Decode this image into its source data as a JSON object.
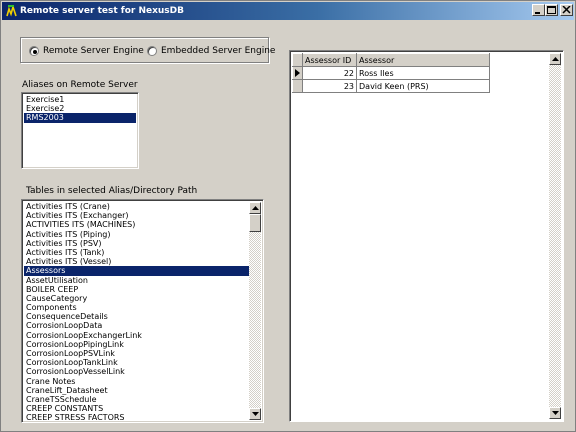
{
  "window": {
    "title": "Remote server test for NexusDB"
  },
  "engine": {
    "remote_label": "Remote Server Engine",
    "embedded_label": "Embedded Server Engine",
    "selected": "remote"
  },
  "aliases": {
    "label": "Aliases on Remote Server",
    "items": [
      "Exercise1",
      "Exercise2",
      "RMS2003"
    ],
    "selected_index": 2
  },
  "tables": {
    "label": "Tables in selected Alias/Directory Path",
    "items": [
      "Activities ITS (Crane)",
      "Activities ITS (Exchanger)",
      "ACTIVITIES ITS (MACHINES)",
      "Activities ITS (Piping)",
      "Activities ITS (PSV)",
      "Activities ITS (Tank)",
      "Activities ITS (Vessel)",
      "Assessors",
      "AssetUtilisation",
      "BOILER CEEP",
      "CauseCategory",
      "Components",
      "ConsequenceDetails",
      "CorrosionLoopData",
      "CorrosionLoopExchangerLink",
      "CorrosionLoopPipingLink",
      "CorrosionLoopPSVLink",
      "CorrosionLoopTankLink",
      "CorrosionLoopVesselLink",
      "Crane Notes",
      "CraneLift_Datasheet",
      "CraneTSSchedule",
      "CREEP CONSTANTS",
      "CREEP STRESS FACTORS"
    ],
    "selected_index": 7
  },
  "grid": {
    "columns": [
      "Assessor ID",
      "Assessor"
    ],
    "rows": [
      {
        "id": "22",
        "name": "Ross Iles"
      },
      {
        "id": "23",
        "name": "David Keen (PRS)"
      }
    ],
    "current_row": 0
  },
  "colors": {
    "selection": "#0a246a",
    "face": "#d4d0c8"
  }
}
